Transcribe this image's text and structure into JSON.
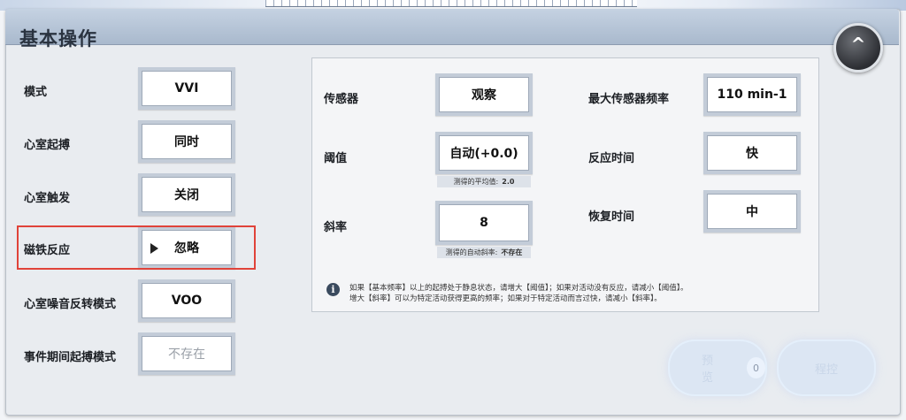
{
  "window": {
    "title": "基本操作",
    "collapse_glyph": "^"
  },
  "left_rows": [
    {
      "label": "模式",
      "value": "VVI"
    },
    {
      "label": "心室起搏",
      "value": "同时"
    },
    {
      "label": "心室触发",
      "value": "关闭"
    },
    {
      "label": "磁铁反应",
      "value": "忽略",
      "selected": true
    },
    {
      "label": "心室噪音反转模式",
      "value": "VOO"
    },
    {
      "label": "事件期间起搏模式",
      "value": "不存在",
      "disabled": true
    }
  ],
  "sensor": {
    "label": "传感器",
    "value": "观察",
    "threshold_label": "阈值",
    "threshold_value": "自动(+0.0)",
    "threshold_caption": "测得的平均值:",
    "threshold_caption_value": "2.0",
    "slope_label": "斜率",
    "slope_value": "8",
    "slope_caption": "测得的自动斜率:",
    "slope_caption_value": "不存在",
    "max_rate_label": "最大传感器频率",
    "max_rate_value": "110 min-1",
    "reaction_label": "反应时间",
    "reaction_value": "快",
    "recovery_label": "恢复时间",
    "recovery_value": "中"
  },
  "info": {
    "icon": "info-icon",
    "line1": "如果【基本频率】以上的起搏处于静息状态，请增大【阈值】；如果对活动没有反应，请减小【阈值】。",
    "line2": "增大【斜率】可以为特定活动获得更高的频率；如果对于特定活动而言过快，请减小【斜率】。"
  },
  "footer": {
    "preview_label": "预览",
    "preview_count": "0",
    "program_label": "程控"
  },
  "colors": {
    "highlight": "#e0433a",
    "titlebar": "#b3c2d5"
  }
}
